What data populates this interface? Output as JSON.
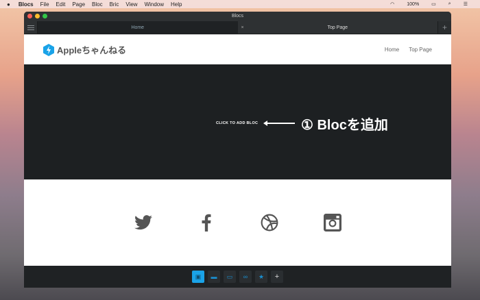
{
  "menubar": {
    "app": "Blocs",
    "items": [
      "File",
      "Edit",
      "Page",
      "Bloc",
      "Bric",
      "View",
      "Window",
      "Help"
    ],
    "battery": "100%"
  },
  "window": {
    "title": "Blocs"
  },
  "tabs": [
    {
      "label": "Home",
      "active": true
    },
    {
      "label": "Top Page",
      "active": false
    }
  ],
  "site": {
    "brand": "Appleちゃんねる",
    "nav": [
      "Home",
      "Top Page"
    ]
  },
  "hero": {
    "cta": "CLICK TO ADD BLOC",
    "annotation": "① Blocを追加"
  },
  "social": [
    "twitter-icon",
    "facebook-icon",
    "dribbble-icon",
    "instagram-icon"
  ],
  "toolbar": [
    "image-bloc",
    "folder",
    "button-bric",
    "link",
    "star",
    "add"
  ],
  "colors": {
    "accent": "#1aa3e8"
  }
}
